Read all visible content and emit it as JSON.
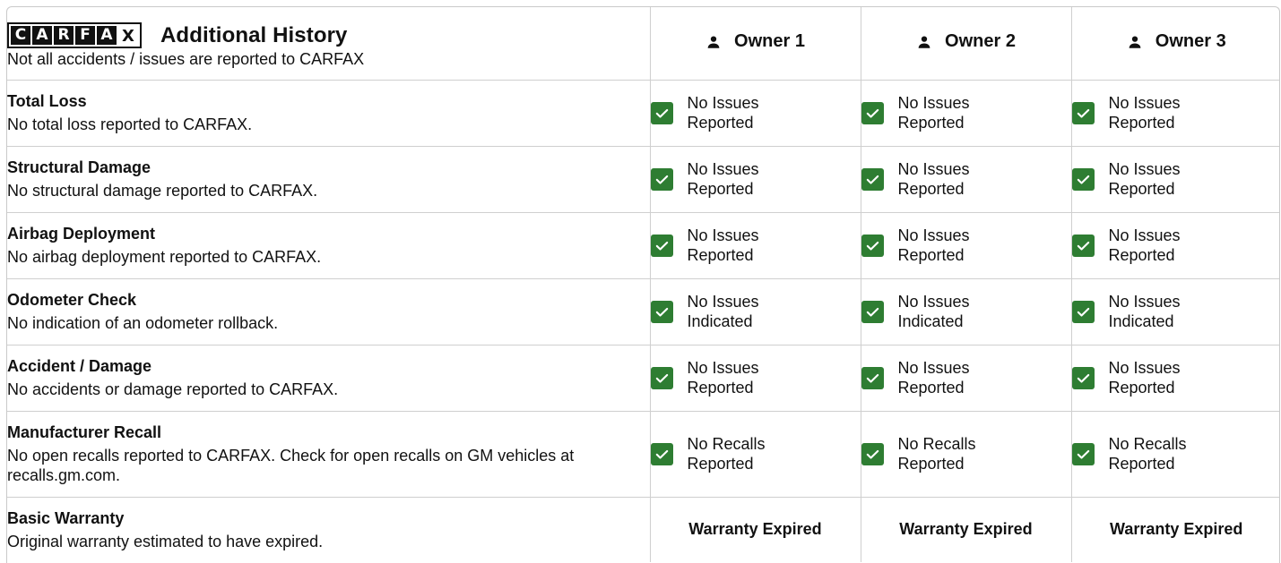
{
  "brand": {
    "logo_letters": [
      "C",
      "A",
      "R",
      "F",
      "A",
      "X"
    ],
    "title": "Additional History",
    "subtitle": "Not all accidents / issues are reported to CARFAX"
  },
  "owners": [
    "Owner 1",
    "Owner 2",
    "Owner 3"
  ],
  "rows": [
    {
      "title": "Total Loss",
      "desc": "No total loss reported to CARFAX.",
      "status": [
        "No Issues",
        "Reported"
      ]
    },
    {
      "title": "Structural Damage",
      "desc": "No structural damage reported to CARFAX.",
      "status": [
        "No Issues",
        "Reported"
      ]
    },
    {
      "title": "Airbag Deployment",
      "desc": "No airbag deployment reported to CARFAX.",
      "status": [
        "No Issues",
        "Reported"
      ]
    },
    {
      "title": "Odometer Check",
      "desc": "No indication of an odometer rollback.",
      "status": [
        "No Issues",
        "Indicated"
      ]
    },
    {
      "title": "Accident / Damage",
      "desc": "No accidents or damage reported to CARFAX.",
      "status": [
        "No Issues",
        "Reported"
      ]
    },
    {
      "title": "Manufacturer Recall",
      "desc": "No open recalls reported to CARFAX. Check for open recalls on GM vehicles at recalls.gm.com.",
      "status": [
        "No Recalls",
        "Reported"
      ]
    },
    {
      "title": "Basic Warranty",
      "desc": "Original warranty estimated to have expired.",
      "warranty": "Warranty Expired"
    }
  ],
  "colors": {
    "check_green": "#2e7d32",
    "border": "#cfcfcf"
  },
  "icons": {
    "owner": "person-icon",
    "status": "check-box-icon"
  }
}
